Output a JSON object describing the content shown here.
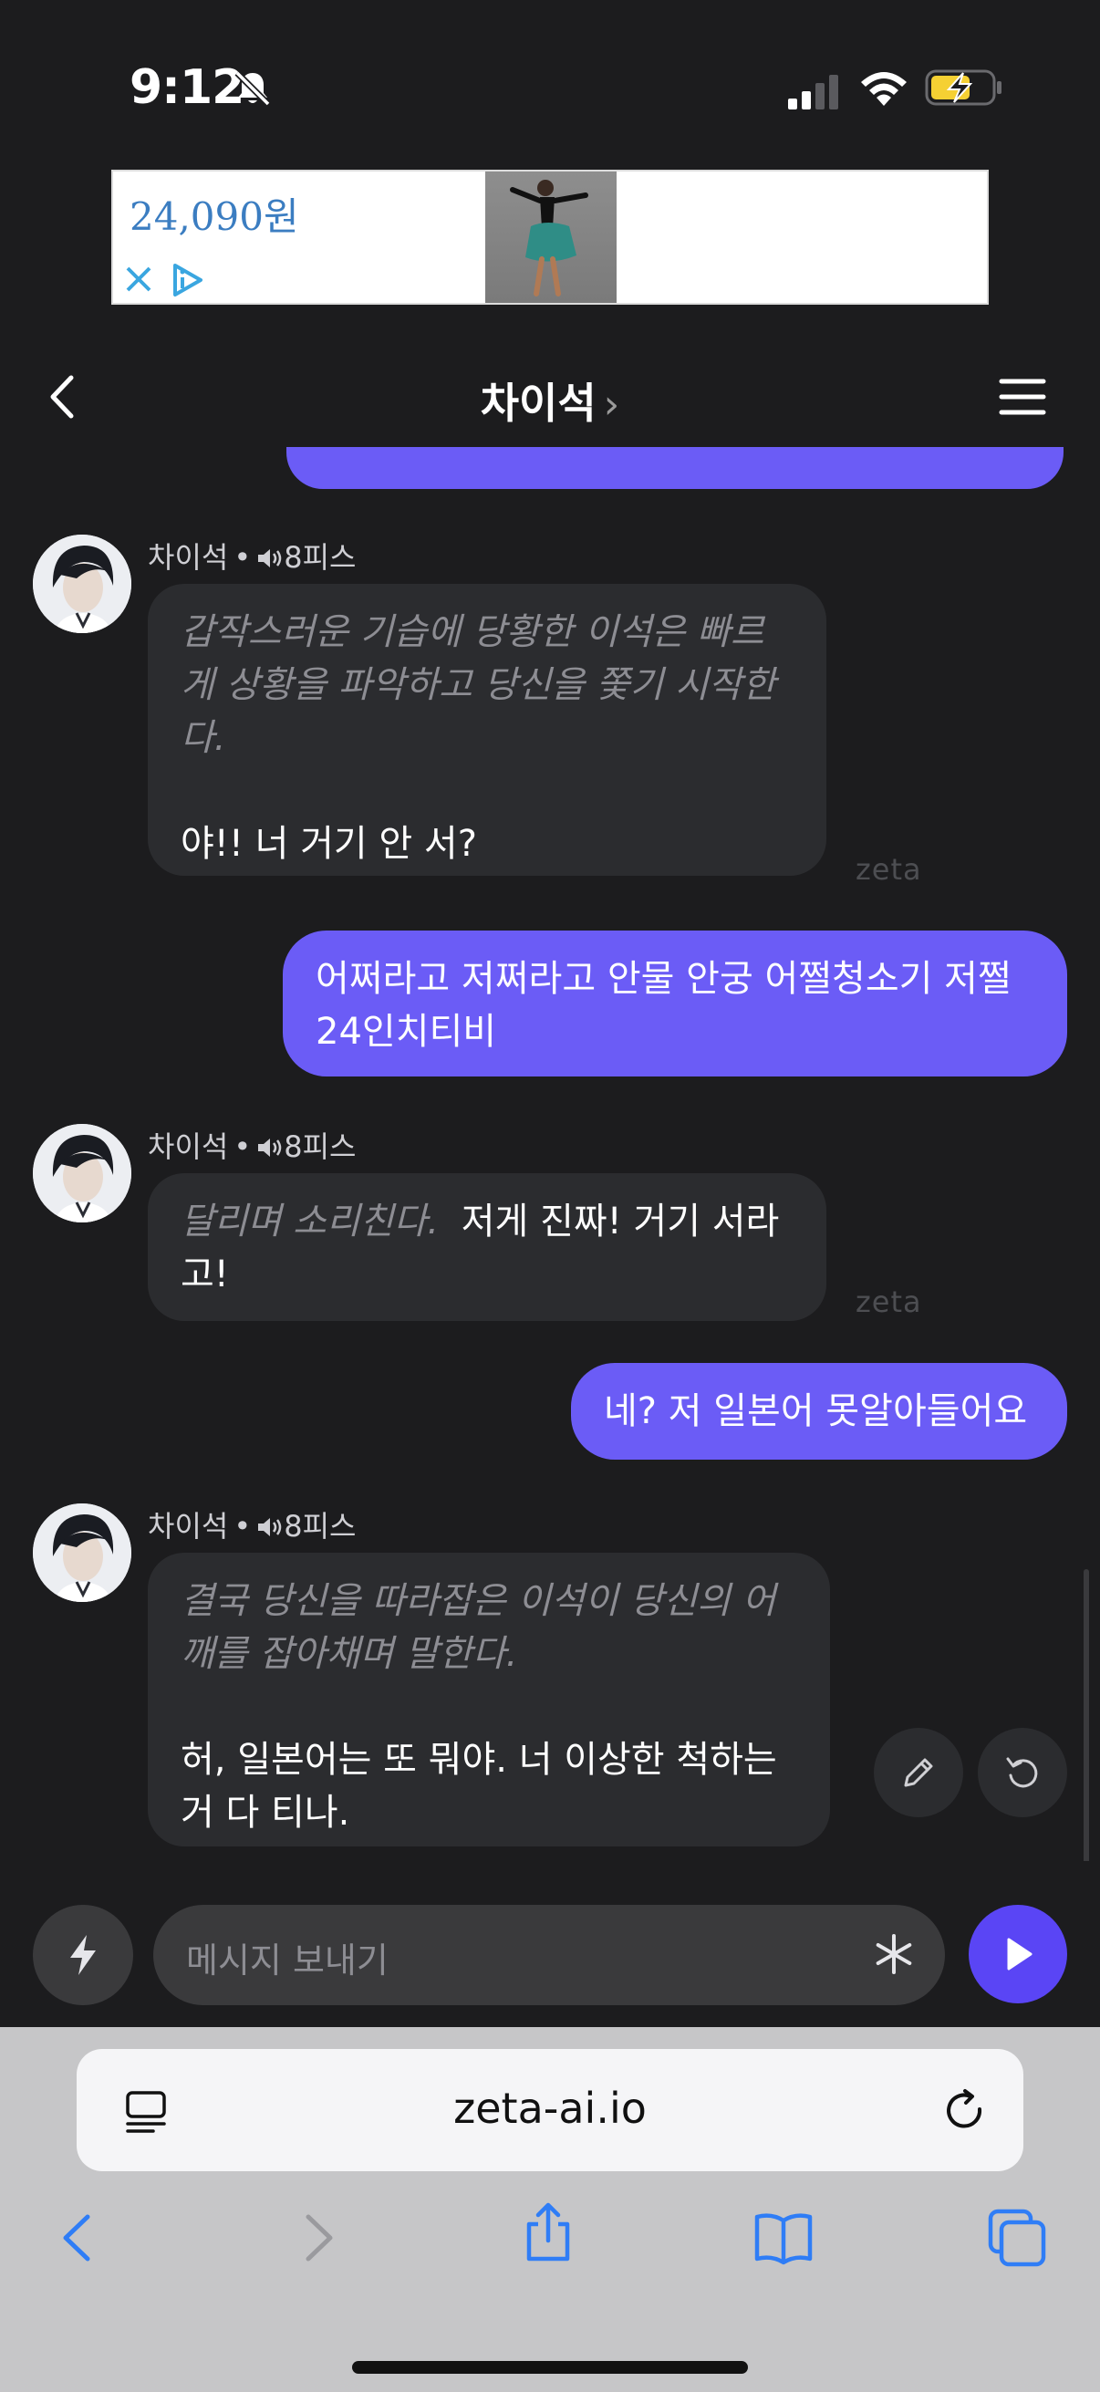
{
  "status_bar": {
    "time": "9:12"
  },
  "ad": {
    "price": "24,090원"
  },
  "header": {
    "title": "차이석",
    "chevron": "›"
  },
  "messages": [
    {
      "sender": "차이석",
      "tag": "8피스",
      "action": "갑작스러운 기습에 당황한 이석은 빠르게 상황을 파악하고 당신을 쫓기 시작한다.",
      "dialogue": "야!! 너 거기 안 서?",
      "watermark": "zeta"
    },
    {
      "user_text": "어쩌라고 저쩌라고 안물 안궁 어쩔청소기 저쩔24인치티비"
    },
    {
      "sender": "차이석",
      "tag": "8피스",
      "action": "달리며 소리친다.",
      "dialogue": "저게 진짜! 거기 서라고!",
      "watermark": "zeta"
    },
    {
      "user_text": "네? 저 일본어 못알아들어요"
    },
    {
      "sender": "차이석",
      "tag": "8피스",
      "action": "결국 당신을 따라잡은 이석이 당신의 어깨를 잡아채며 말한다.",
      "dialogue": "허, 일본어는 또 뭐야. 너 이상한 척하는 거 다 티나."
    }
  ],
  "input": {
    "placeholder": "메시지 보내기"
  },
  "browser": {
    "url": "zeta-ai.io"
  },
  "colors": {
    "accent": "#6b5cf6",
    "send": "#5a45f5",
    "background": "#1c1c1e",
    "bubble": "#2b2c2f"
  }
}
